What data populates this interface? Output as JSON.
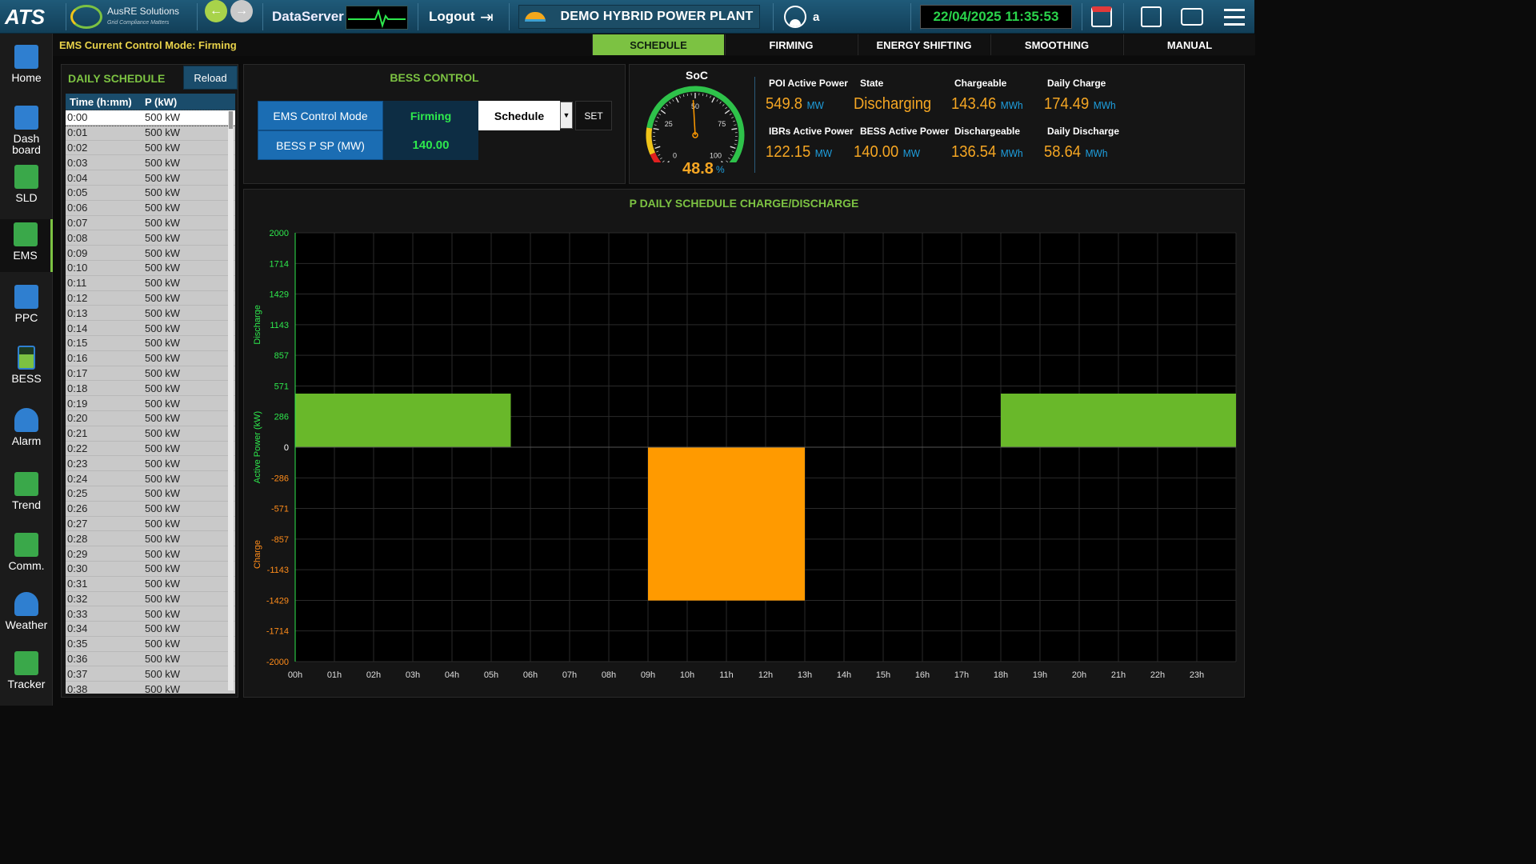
{
  "topbar": {
    "logo": "ATS",
    "brand_name": "AusRE Solutions",
    "brand_tagline": "Grid Compliance Matters",
    "dataserver": "DataServer",
    "logout": "Logout",
    "plant_name": "DEMO HYBRID POWER PLANT",
    "username": "a",
    "datetime": "22/04/2025 11:35:53"
  },
  "sidebar": [
    {
      "label": "Home",
      "icon": "home-icon",
      "color": "#2f7fd0"
    },
    {
      "label": "Dash board",
      "icon": "dashboard-icon",
      "color": "#2f7fd0"
    },
    {
      "label": "SLD",
      "icon": "sld-icon",
      "color": "#3aa84a"
    },
    {
      "label": "EMS",
      "icon": "tools-icon",
      "color": "#3aa84a"
    },
    {
      "label": "PPC",
      "icon": "solar-panel-icon",
      "color": "#2f7fd0"
    },
    {
      "label": "BESS",
      "icon": "battery-icon",
      "color": "#7cc242"
    },
    {
      "label": "Alarm",
      "icon": "bell-icon",
      "color": "#2f7fd0"
    },
    {
      "label": "Trend",
      "icon": "trend-icon",
      "color": "#3aa84a"
    },
    {
      "label": "Comm.",
      "icon": "network-icon",
      "color": "#3aa84a"
    },
    {
      "label": "Weather",
      "icon": "weather-icon",
      "color": "#2f7fd0"
    },
    {
      "label": "Tracker",
      "icon": "tracker-icon",
      "color": "#3aa84a"
    }
  ],
  "mode_bar": {
    "current_mode": "EMS Current Control Mode: Firming",
    "tabs": [
      "SCHEDULE",
      "FIRMING",
      "ENERGY SHIFTING",
      "SMOOTHING",
      "MANUAL"
    ],
    "active_tab": "SCHEDULE"
  },
  "schedule": {
    "title": "DAILY SCHEDULE",
    "reload": "Reload",
    "columns": [
      "Time (h:mm)",
      "P (kW)"
    ],
    "rows": [
      [
        "0:00",
        "500 kW"
      ],
      [
        "0:01",
        "500 kW"
      ],
      [
        "0:02",
        "500 kW"
      ],
      [
        "0:03",
        "500 kW"
      ],
      [
        "0:04",
        "500 kW"
      ],
      [
        "0:05",
        "500 kW"
      ],
      [
        "0:06",
        "500 kW"
      ],
      [
        "0:07",
        "500 kW"
      ],
      [
        "0:08",
        "500 kW"
      ],
      [
        "0:09",
        "500 kW"
      ],
      [
        "0:10",
        "500 kW"
      ],
      [
        "0:11",
        "500 kW"
      ],
      [
        "0:12",
        "500 kW"
      ],
      [
        "0:13",
        "500 kW"
      ],
      [
        "0:14",
        "500 kW"
      ],
      [
        "0:15",
        "500 kW"
      ],
      [
        "0:16",
        "500 kW"
      ],
      [
        "0:17",
        "500 kW"
      ],
      [
        "0:18",
        "500 kW"
      ],
      [
        "0:19",
        "500 kW"
      ],
      [
        "0:20",
        "500 kW"
      ],
      [
        "0:21",
        "500 kW"
      ],
      [
        "0:22",
        "500 kW"
      ],
      [
        "0:23",
        "500 kW"
      ],
      [
        "0:24",
        "500 kW"
      ],
      [
        "0:25",
        "500 kW"
      ],
      [
        "0:26",
        "500 kW"
      ],
      [
        "0:27",
        "500 kW"
      ],
      [
        "0:28",
        "500 kW"
      ],
      [
        "0:29",
        "500 kW"
      ],
      [
        "0:30",
        "500 kW"
      ],
      [
        "0:31",
        "500 kW"
      ],
      [
        "0:32",
        "500 kW"
      ],
      [
        "0:33",
        "500 kW"
      ],
      [
        "0:34",
        "500 kW"
      ],
      [
        "0:35",
        "500 kW"
      ],
      [
        "0:36",
        "500 kW"
      ],
      [
        "0:37",
        "500 kW"
      ],
      [
        "0:38",
        "500 kW"
      ]
    ]
  },
  "bess_control": {
    "title": "BESS CONTROL",
    "mode_label": "EMS Control Mode",
    "mode_value": "Firming",
    "mode_select": "Schedule",
    "set": "SET",
    "sp_label": "BESS P SP (MW)",
    "sp_value": "140.00"
  },
  "soc": {
    "label": "SoC",
    "value": "48.8",
    "unit": "%",
    "fraction": 0.488,
    "ticks": [
      "0",
      "25",
      "50",
      "75",
      "100"
    ]
  },
  "metrics": [
    {
      "label": "POI Active Power",
      "value": "549.8",
      "unit": "MW"
    },
    {
      "label": "State",
      "value": "Discharging",
      "unit": ""
    },
    {
      "label": "Chargeable",
      "value": "143.46",
      "unit": "MWh"
    },
    {
      "label": "Daily Charge",
      "value": "174.49",
      "unit": "MWh"
    },
    {
      "label": "IBRs Active Power",
      "value": "122.15",
      "unit": "MW"
    },
    {
      "label": "BESS Active Power",
      "value": "140.00",
      "unit": "MW"
    },
    {
      "label": "Dischargeable",
      "value": "136.54",
      "unit": "MWh"
    },
    {
      "label": "Daily Discharge",
      "value": "58.64",
      "unit": "MWh"
    }
  ],
  "chart_data": {
    "type": "bar",
    "title": "P DAILY SCHEDULE CHARGE/DISCHARGE",
    "ylabel": "Active Power (kW)",
    "ylabel_upper": "Discharge",
    "ylabel_lower": "Charge",
    "ylim": [
      -2000,
      2000
    ],
    "yticks": [
      2000,
      1714,
      1429,
      1143,
      857,
      571,
      286,
      0,
      -286,
      -571,
      -857,
      -1143,
      -1429,
      -1714,
      -2000
    ],
    "xticks": [
      "00h",
      "01h",
      "02h",
      "03h",
      "04h",
      "05h",
      "06h",
      "07h",
      "08h",
      "09h",
      "10h",
      "11h",
      "12h",
      "13h",
      "14h",
      "15h",
      "16h",
      "17h",
      "18h",
      "19h",
      "20h",
      "21h",
      "22h",
      "23h"
    ],
    "xlim": [
      0,
      24
    ],
    "grid": true,
    "discharge_color": "#69b82a",
    "charge_color": "#ff9a00",
    "segments": [
      {
        "start_h": 0,
        "end_h": 5.5,
        "value": 500
      },
      {
        "start_h": 9,
        "end_h": 13,
        "value": -1430
      },
      {
        "start_h": 18,
        "end_h": 24,
        "value": 500
      }
    ]
  }
}
